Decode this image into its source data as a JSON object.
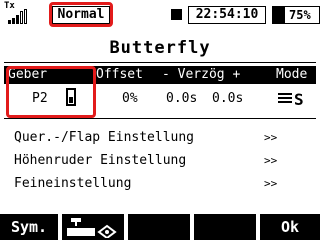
{
  "status": {
    "tx_label": "Tx",
    "mode": "Normal",
    "timer": "22:54:10",
    "battery": "75%"
  },
  "screen": {
    "title": "Butterfly"
  },
  "table": {
    "headers": [
      "Geber",
      "Offset",
      "- Verzög +",
      "Mode"
    ],
    "row": {
      "geber": "P2",
      "offset": "0%",
      "delay_minus": "0.0s",
      "delay_plus": "0.0s",
      "mode": "S"
    }
  },
  "menu": [
    {
      "label": "Quer.-/Flap Einstellung",
      "arrow": ">>"
    },
    {
      "label": "Höhenruder Einstellung",
      "arrow": ">>"
    },
    {
      "label": "Feineinstellung",
      "arrow": ">>"
    }
  ],
  "softkeys": [
    "Sym.",
    "",
    "",
    "",
    "Ok"
  ],
  "colors": {
    "highlight": "#e21b1b"
  },
  "icons": {
    "switch": "toggle-switch-icon",
    "mode": "servo-mode-icon",
    "softkey2": "model-view-icon"
  }
}
